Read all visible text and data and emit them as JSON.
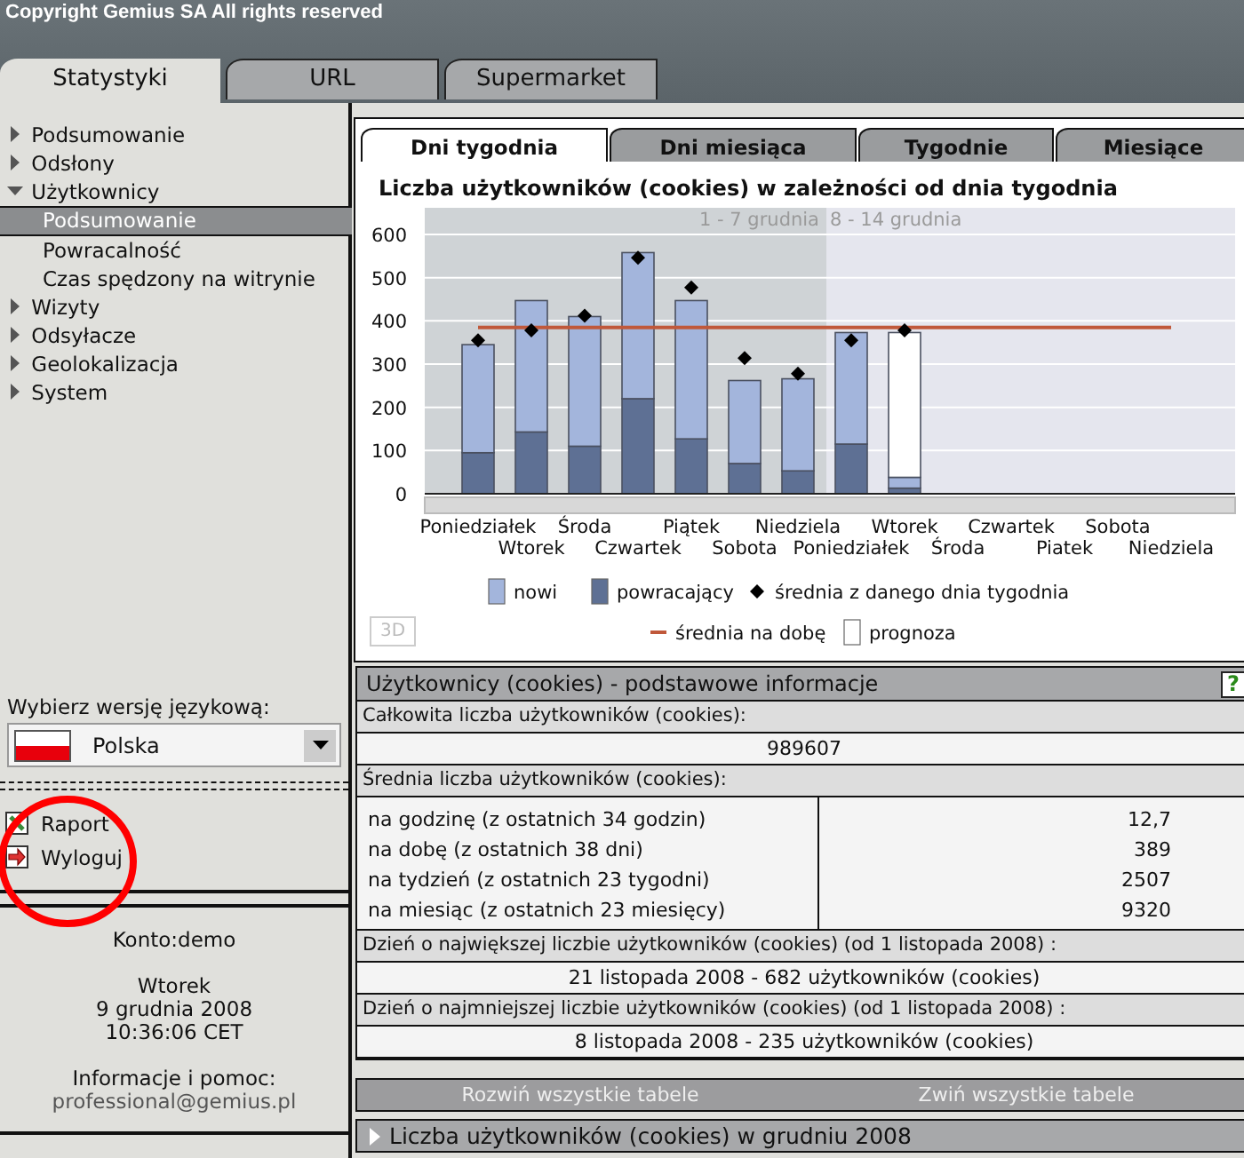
{
  "header": {
    "copyright": "Copyright Gemius SA  All rights reserved"
  },
  "main_tabs": [
    {
      "label": "Statystyki",
      "selected": true
    },
    {
      "label": "URL",
      "selected": false
    },
    {
      "label": "Supermarket",
      "selected": false
    }
  ],
  "sidebar": {
    "items": [
      {
        "label": "Podsumowanie",
        "expanded": false,
        "selected": false
      },
      {
        "label": "Odsłony",
        "expanded": false,
        "selected": false
      },
      {
        "label": "Użytkownicy",
        "expanded": true,
        "selected": false,
        "children": [
          {
            "label": "Podsumowanie",
            "selected": true
          },
          {
            "label": "Powracalność",
            "selected": false
          },
          {
            "label": "Czas spędzony na witrynie",
            "selected": false
          }
        ]
      },
      {
        "label": "Wizyty",
        "expanded": false,
        "selected": false
      },
      {
        "label": "Odsyłacze",
        "expanded": false,
        "selected": false
      },
      {
        "label": "Geolokalizacja",
        "expanded": false,
        "selected": false
      },
      {
        "label": "System",
        "expanded": false,
        "selected": false
      }
    ],
    "language_label": "Wybierz wersję językową:",
    "language": "Polska",
    "links": [
      {
        "label": "Raport",
        "kind": "report"
      },
      {
        "label": "Wyloguj",
        "kind": "logout"
      }
    ],
    "account": "Konto:demo",
    "day": "Wtorek",
    "date": "9 grudnia 2008",
    "time": "10:36:06 CET",
    "help_label": "Informacje i pomoc:",
    "help_email": "professional@gemius.pl"
  },
  "chart_tabs": [
    {
      "label": "Dni tygodnia",
      "selected": true
    },
    {
      "label": "Dni miesiąca",
      "selected": false
    },
    {
      "label": "Tygodnie",
      "selected": false
    },
    {
      "label": "Miesiące",
      "selected": false
    }
  ],
  "chart": {
    "button_3d": "3D",
    "periods": [
      "1 - 7 grudnia",
      "8 - 14 grudnia"
    ],
    "chart_data": {
      "type": "bar",
      "stacked": true,
      "title": "Liczba użytkowników (cookies) w zależności od dnia tygodnia",
      "categories": [
        "Poniedziałek",
        "Wtorek",
        "Środa",
        "Czwartek",
        "Piątek",
        "Sobota",
        "Niedziela",
        "Poniedziałek",
        "Wtorek",
        "Środa",
        "Czwartek",
        "Piatek",
        "Sobota",
        "Niedziela"
      ],
      "ylim": [
        0,
        600
      ],
      "legend": "bottom",
      "yticks": [
        0,
        100,
        200,
        300,
        400,
        500,
        600
      ],
      "series": [
        {
          "name": "powracający",
          "type": "bar",
          "color": "#5e7094",
          "values": [
            95,
            143,
            110,
            220,
            127,
            70,
            53,
            115,
            13,
            null,
            null,
            null,
            null,
            null
          ]
        },
        {
          "name": "nowi",
          "type": "bar",
          "color": "#a3b5dc",
          "values": [
            250,
            304,
            300,
            338,
            320,
            192,
            213,
            258,
            25,
            null,
            null,
            null,
            null,
            null
          ]
        },
        {
          "name": "prognoza",
          "type": "bar",
          "color": "#ffffff",
          "values": [
            null,
            null,
            null,
            null,
            null,
            null,
            null,
            null,
            335,
            null,
            null,
            null,
            null,
            null
          ]
        },
        {
          "name": "średnia z danego dnia tygodnia",
          "type": "scatter",
          "color": "#000000",
          "values": [
            355,
            378,
            412,
            546,
            477,
            314,
            278,
            355,
            378,
            null,
            null,
            null,
            null,
            null
          ]
        },
        {
          "name": "średnia na dobę",
          "type": "line",
          "color": "#c0583a",
          "values": [
            385,
            385,
            385,
            385,
            385,
            385,
            385,
            385,
            385,
            385,
            385,
            385,
            385,
            385
          ]
        }
      ]
    }
  },
  "info": {
    "title": "Użytkownicy (cookies) - podstawowe informacje",
    "help": "?",
    "total_label": "Całkowita liczba użytkowników (cookies):",
    "total": "989607",
    "avg_label": "Średnia liczba użytkowników (cookies):",
    "averages": [
      {
        "label": "na godzinę (z ostatnich 34 godzin)",
        "value": "12,7"
      },
      {
        "label": "na dobę (z ostatnich 38 dni)",
        "value": "389"
      },
      {
        "label": "na tydzień (z ostatnich 23 tygodni)",
        "value": "2507"
      },
      {
        "label": "na miesiąc (z ostatnich 23 miesięcy)",
        "value": "9320"
      }
    ],
    "max_label": "Dzień o największej liczbie użytkowników (cookies) (od 1 listopada 2008) :",
    "max": "21 listopada 2008 - 682 użytkowników (cookies)",
    "min_label": "Dzień o najmniejszej liczbie użytkowników (cookies) (od 1 listopada 2008) :",
    "min": "8 listopada 2008 - 235 użytkowników (cookies)"
  },
  "actions": [
    "Rozwiń wszystkie tabele",
    "Zwiń wszystkie tabele"
  ],
  "collapsed_section": {
    "label": "Liczba użytkowników (cookies) w grudniu 2008",
    "expanded": false
  }
}
